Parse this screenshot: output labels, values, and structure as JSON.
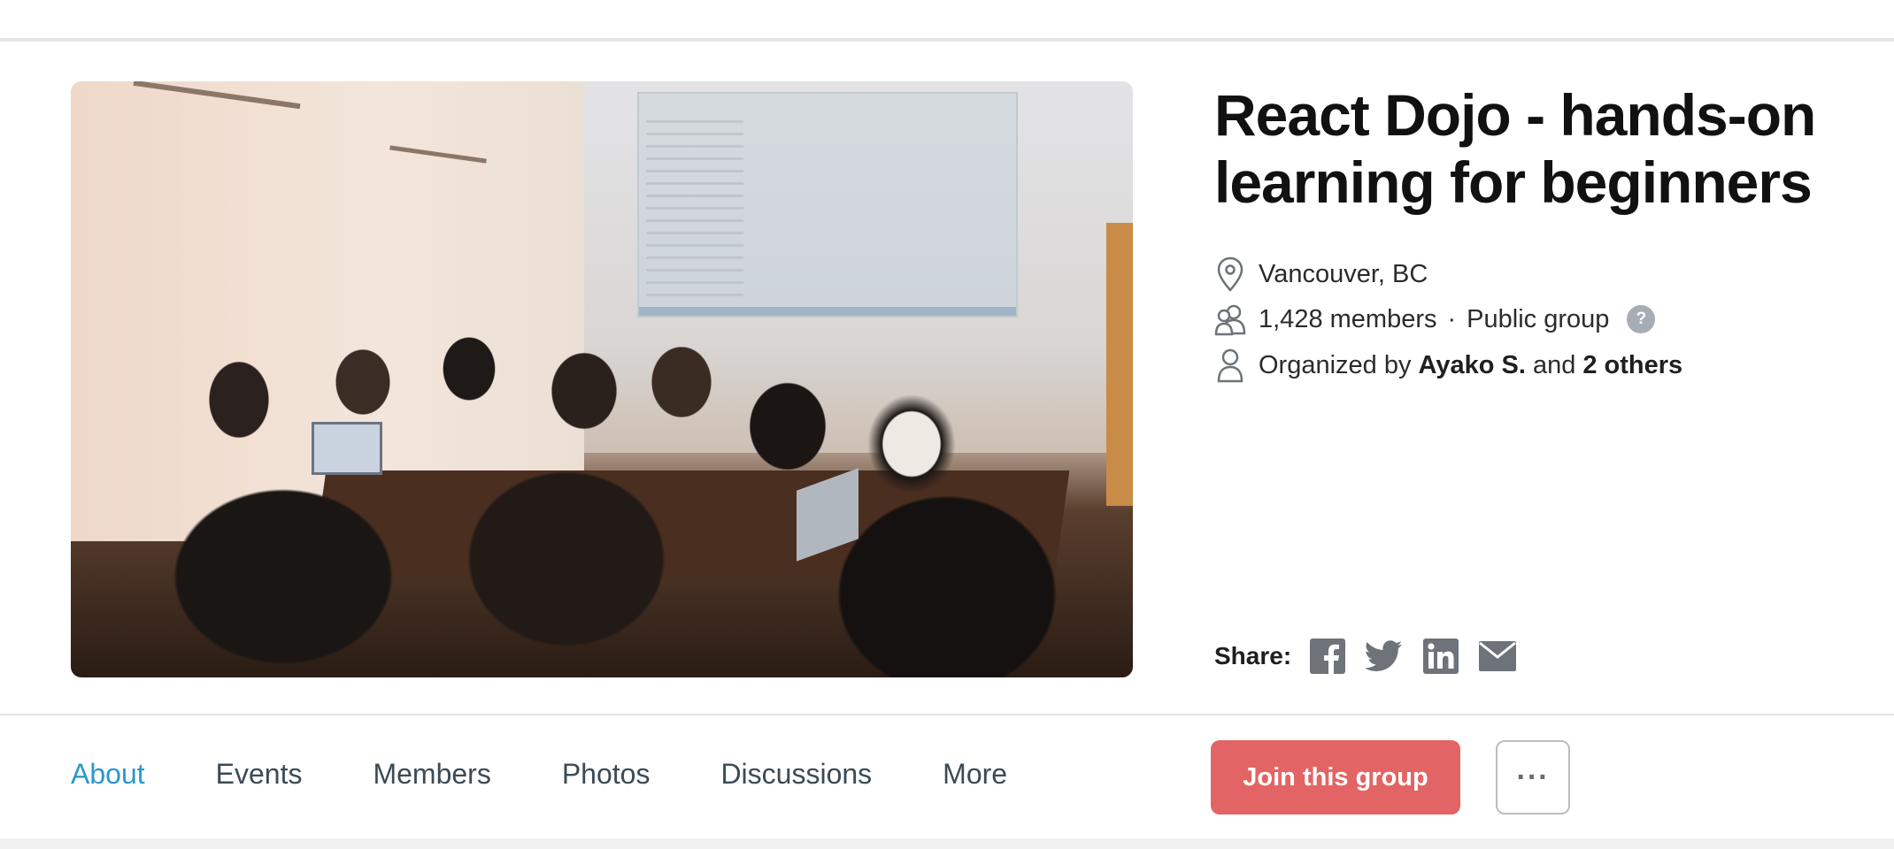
{
  "group": {
    "title": "React Dojo - hands-on learning for beginners",
    "location": "Vancouver, BC",
    "members": "1,428 members",
    "separator": "·",
    "visibility": "Public group",
    "help_glyph": "?",
    "organized_prefix": "Organized by",
    "organizer_name": "Ayako S.",
    "organized_and": "and",
    "organized_others": "2 others"
  },
  "share": {
    "label": "Share:",
    "icons": [
      "facebook-icon",
      "twitter-icon",
      "linkedin-icon",
      "email-icon"
    ]
  },
  "tabs": [
    {
      "label": "About",
      "active": true
    },
    {
      "label": "Events",
      "active": false
    },
    {
      "label": "Members",
      "active": false
    },
    {
      "label": "Photos",
      "active": false
    },
    {
      "label": "Discussions",
      "active": false
    },
    {
      "label": "More",
      "active": false
    }
  ],
  "actions": {
    "join_label": "Join this group",
    "more_label": "···"
  },
  "colors": {
    "tab_active": "#2b99c9",
    "join_button": "#e36464",
    "title_text": "#111111",
    "icon_gray": "#6d7379"
  }
}
